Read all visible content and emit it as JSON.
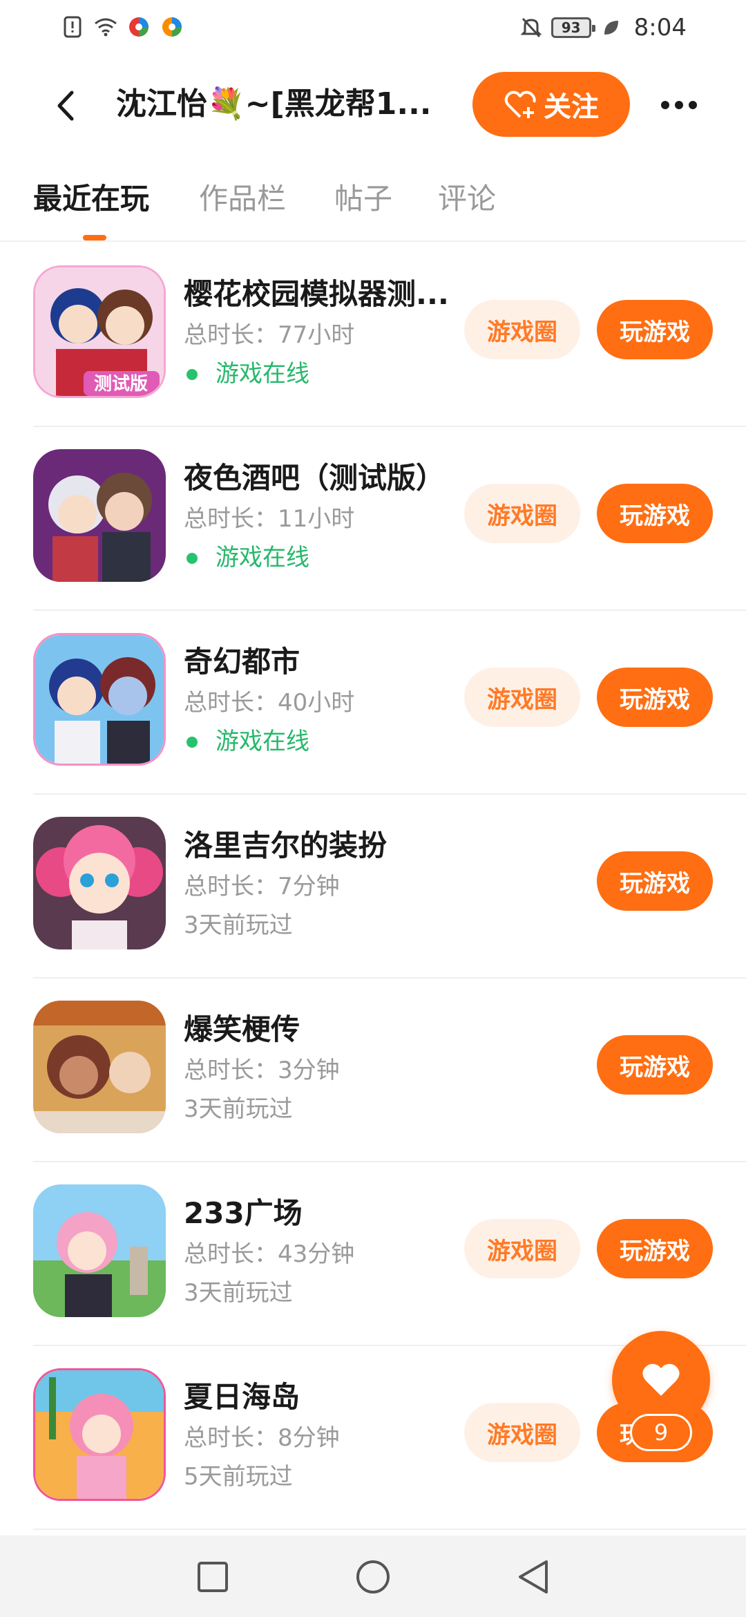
{
  "status_bar": {
    "time": "8:04",
    "battery": "93",
    "icons": [
      "alert-icon",
      "wifi-icon",
      "app-icon",
      "app-icon",
      "mute-icon",
      "battery-icon",
      "leaf-icon"
    ]
  },
  "header": {
    "title": "沈江怡💐~[黑龙帮1...",
    "follow_label": "关注"
  },
  "tabs": [
    {
      "label": "最近在玩",
      "active": true
    },
    {
      "label": "作品栏",
      "active": false
    },
    {
      "label": "帖子",
      "active": false
    },
    {
      "label": "评论",
      "active": false
    }
  ],
  "games": [
    {
      "name": "樱花校园模拟器测...",
      "duration": "总时长：77小时",
      "status": "游戏在线",
      "online": true,
      "circle_label": "游戏圈",
      "play_label": "玩游戏"
    },
    {
      "name": "夜色酒吧（测试版）",
      "duration": "总时长：11小时",
      "status": "游戏在线",
      "online": true,
      "circle_label": "游戏圈",
      "play_label": "玩游戏"
    },
    {
      "name": "奇幻都市",
      "duration": "总时长：40小时",
      "status": "游戏在线",
      "online": true,
      "circle_label": "游戏圈",
      "play_label": "玩游戏"
    },
    {
      "name": "洛里吉尔的装扮",
      "duration": "总时长：7分钟",
      "status": "3天前玩过",
      "online": false,
      "circle_label": "",
      "play_label": "玩游戏"
    },
    {
      "name": "爆笑梗传",
      "duration": "总时长：3分钟",
      "status": "3天前玩过",
      "online": false,
      "circle_label": "",
      "play_label": "玩游戏"
    },
    {
      "name": "233广场",
      "duration": "总时长：43分钟",
      "status": "3天前玩过",
      "online": false,
      "circle_label": "游戏圈",
      "play_label": "玩游戏"
    },
    {
      "name": "夏日海岛",
      "duration": "总时长：8分钟",
      "status": "5天前玩过",
      "online": false,
      "circle_label": "游戏圈",
      "play_label": "玩游戏"
    }
  ],
  "like": {
    "count": "9"
  },
  "colors": {
    "accent": "#ff6e12",
    "online": "#27b86c",
    "circle_bg": "#fff0e6"
  }
}
